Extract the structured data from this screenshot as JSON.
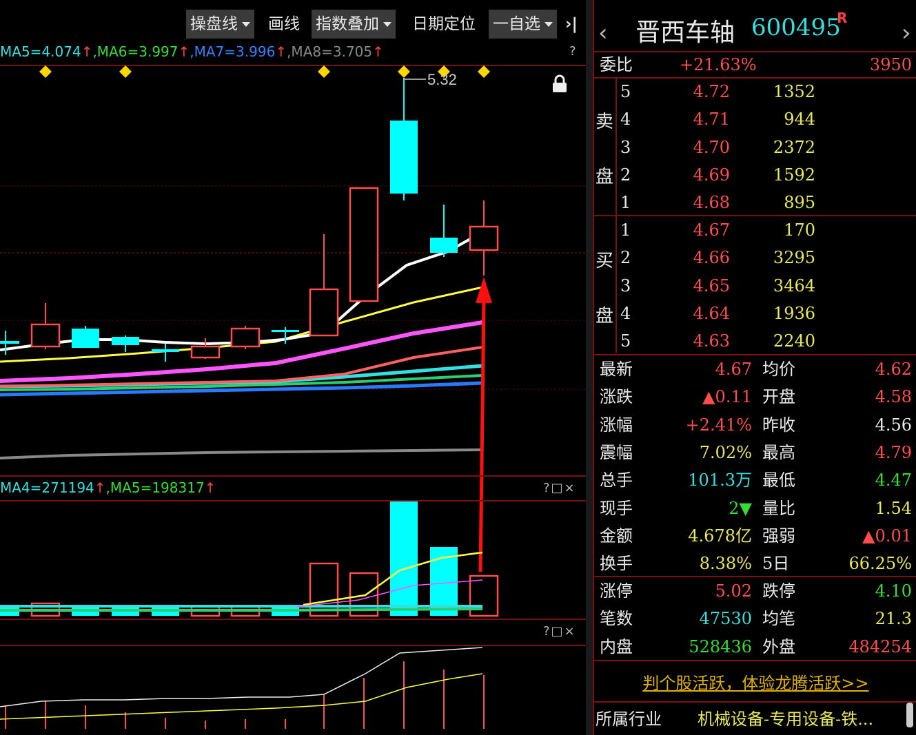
{
  "toolbar": {
    "btn_caopan": "操盘线",
    "btn_huaxian": "画线",
    "btn_zhishu": "指数叠加",
    "btn_riqi": "日期定位",
    "btn_zixuan": "一自选",
    "btn_collapse": "›|"
  },
  "ma_line": [
    {
      "text": "MA5=4.074",
      "color": "#33e0e0"
    },
    {
      "text": "↑",
      "color": "#ff4040"
    },
    {
      "text": ",MA6=3.997",
      "color": "#33dd33"
    },
    {
      "text": "↑",
      "color": "#ff4040"
    },
    {
      "text": ",MA7=3.996",
      "color": "#3380ff"
    },
    {
      "text": "↑",
      "color": "#ff4040"
    },
    {
      "text": ",MA8=3.705",
      "color": "#888888"
    },
    {
      "text": "↑",
      "color": "#ff4040"
    }
  ],
  "ma_help": "?",
  "high_label": "5.32",
  "vol_line": [
    {
      "text": "MA4=271194",
      "color": "#33e0e0"
    },
    {
      "text": "↑",
      "color": "#ff4040"
    },
    {
      "text": ",MA5=198317",
      "color": "#33dd33"
    },
    {
      "text": "↑",
      "color": "#ff4040"
    }
  ],
  "pane_tools": "?□×",
  "quote": {
    "name": "晋西车轴",
    "code": "600495",
    "badge": "R",
    "prev": "‹",
    "next": "›",
    "webi_label": "委比",
    "webi_value": "+21.63%",
    "webi_diff": "3950",
    "sell_label_1": "卖",
    "sell_label_2": "盘",
    "buy_label_1": "买",
    "buy_label_2": "盘",
    "sell": [
      {
        "lvl": "5",
        "price": "4.72",
        "vol": "1352"
      },
      {
        "lvl": "4",
        "price": "4.71",
        "vol": "944"
      },
      {
        "lvl": "3",
        "price": "4.70",
        "vol": "2372"
      },
      {
        "lvl": "2",
        "price": "4.69",
        "vol": "1592"
      },
      {
        "lvl": "1",
        "price": "4.68",
        "vol": "895"
      }
    ],
    "buy": [
      {
        "lvl": "1",
        "price": "4.67",
        "vol": "170"
      },
      {
        "lvl": "2",
        "price": "4.66",
        "vol": "3295"
      },
      {
        "lvl": "3",
        "price": "4.65",
        "vol": "3464"
      },
      {
        "lvl": "4",
        "price": "4.64",
        "vol": "1936"
      },
      {
        "lvl": "5",
        "price": "4.63",
        "vol": "2240"
      }
    ],
    "stats": [
      {
        "l1": "最新",
        "v1": "4.67",
        "c1": "c-red",
        "l2": "均价",
        "v2": "4.62",
        "c2": "c-red"
      },
      {
        "l1": "涨跌",
        "v1": "▲0.11",
        "c1": "c-red",
        "l2": "开盘",
        "v2": "4.58",
        "c2": "c-red"
      },
      {
        "l1": "涨幅",
        "v1": "+2.41%",
        "c1": "c-red",
        "l2": "昨收",
        "v2": "4.56",
        "c2": "c-white"
      },
      {
        "l1": "震幅",
        "v1": "7.02%",
        "c1": "c-yellow",
        "l2": "最高",
        "v2": "4.79",
        "c2": "c-red"
      },
      {
        "l1": "总手",
        "v1": "101.3万",
        "c1": "c-cyan",
        "l2": "最低",
        "v2": "4.47",
        "c2": "c-green"
      },
      {
        "l1": "现手",
        "v1": "2▼",
        "c1": "c-green",
        "l2": "量比",
        "v2": "1.54",
        "c2": "c-yellow"
      },
      {
        "l1": "金额",
        "v1": "4.678亿",
        "c1": "c-yellow",
        "l2": "强弱",
        "v2": "▲0.01",
        "c2": "c-red"
      },
      {
        "l1": "换手",
        "v1": "8.38%",
        "c1": "c-yellow",
        "l2": "5日",
        "v2": "66.25%",
        "c2": "c-yellow"
      }
    ],
    "limits": [
      {
        "l1": "涨停",
        "v1": "5.02",
        "c1": "c-red",
        "l2": "跌停",
        "v2": "4.10",
        "c2": "c-green"
      },
      {
        "l1": "笔数",
        "v1": "47530",
        "c1": "c-cyan",
        "l2": "均笔",
        "v2": "21.3",
        "c2": "c-yellow"
      },
      {
        "l1": "内盘",
        "v1": "528436",
        "c1": "c-green",
        "l2": "外盘",
        "v2": "484254",
        "c2": "c-red"
      }
    ],
    "promo": "判个股活跃，体验龙腾活跃>>",
    "industry_label": "所属行业",
    "industry_value": "机械设备-专用设备-铁..."
  },
  "colors": {
    "up": "#ff4d4d",
    "down": "#00ffff",
    "ma_white": "#ffffff",
    "ma_yellow": "#ffff44",
    "ma_magenta": "#ff55ff",
    "ma_salmon": "#ff6060",
    "ma_cyan": "#33e0e0",
    "ma_blue": "#2a7aff",
    "ma_gray": "#888888",
    "annotation": "#ff1010",
    "marker": "#ffd700"
  }
}
